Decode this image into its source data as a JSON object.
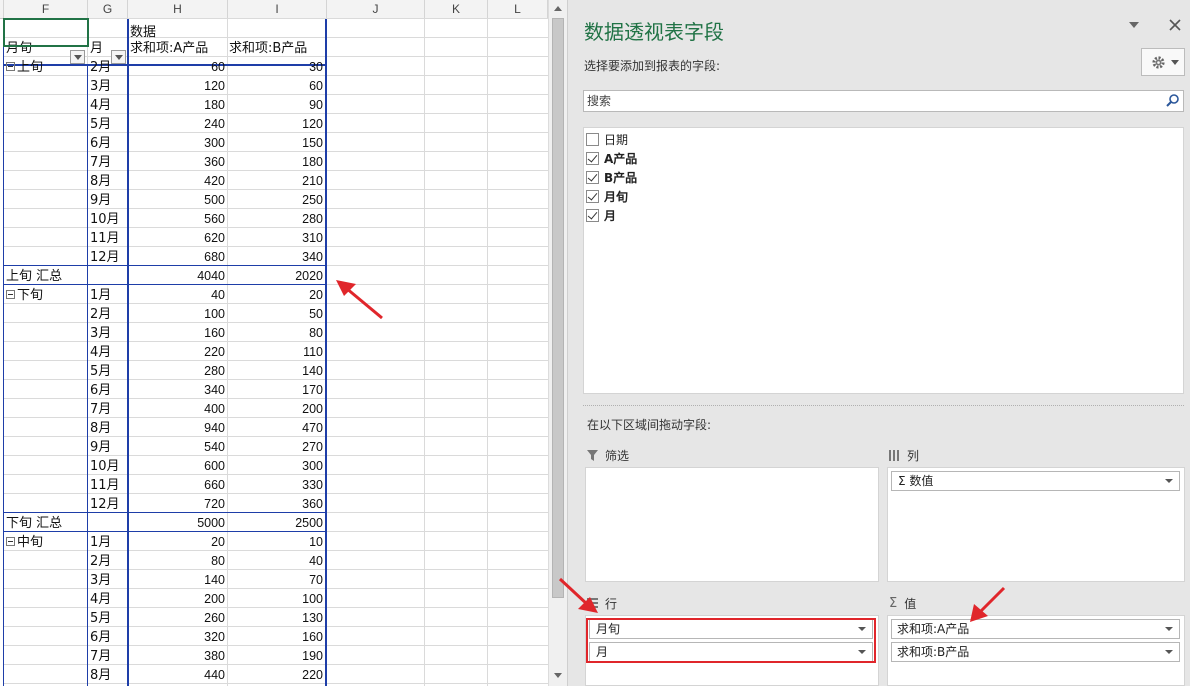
{
  "sheet": {
    "columns": [
      "F",
      "G",
      "H",
      "I",
      "J",
      "K",
      "L"
    ],
    "pivot": {
      "header_data": "数据",
      "hdr_row": "月旬",
      "hdr_month": "月",
      "hdr_a": "求和项:A产品",
      "hdr_b": "求和项:B产品",
      "groups": [
        {
          "name": "上旬",
          "rows": [
            [
              "2月",
              "60",
              "30"
            ],
            [
              "3月",
              "120",
              "60"
            ],
            [
              "4月",
              "180",
              "90"
            ],
            [
              "5月",
              "240",
              "120"
            ],
            [
              "6月",
              "300",
              "150"
            ],
            [
              "7月",
              "360",
              "180"
            ],
            [
              "8月",
              "420",
              "210"
            ],
            [
              "9月",
              "500",
              "250"
            ],
            [
              "10月",
              "560",
              "280"
            ],
            [
              "11月",
              "620",
              "310"
            ],
            [
              "12月",
              "680",
              "340"
            ]
          ],
          "subtotal_label": "上旬 汇总",
          "subtotal_a": "4040",
          "subtotal_b": "2020"
        },
        {
          "name": "下旬",
          "rows": [
            [
              "1月",
              "40",
              "20"
            ],
            [
              "2月",
              "100",
              "50"
            ],
            [
              "3月",
              "160",
              "80"
            ],
            [
              "4月",
              "220",
              "110"
            ],
            [
              "5月",
              "280",
              "140"
            ],
            [
              "6月",
              "340",
              "170"
            ],
            [
              "7月",
              "400",
              "200"
            ],
            [
              "8月",
              "940",
              "470"
            ],
            [
              "9月",
              "540",
              "270"
            ],
            [
              "10月",
              "600",
              "300"
            ],
            [
              "11月",
              "660",
              "330"
            ],
            [
              "12月",
              "720",
              "360"
            ]
          ],
          "subtotal_label": "下旬 汇总",
          "subtotal_a": "5000",
          "subtotal_b": "2500"
        },
        {
          "name": "中旬",
          "rows": [
            [
              "1月",
              "20",
              "10"
            ],
            [
              "2月",
              "80",
              "40"
            ],
            [
              "3月",
              "140",
              "70"
            ],
            [
              "4月",
              "200",
              "100"
            ],
            [
              "5月",
              "260",
              "130"
            ],
            [
              "6月",
              "320",
              "160"
            ],
            [
              "7月",
              "380",
              "190"
            ],
            [
              "8月",
              "440",
              "220"
            ]
          ]
        }
      ]
    }
  },
  "pane": {
    "title": "数据透视表字段",
    "choose_label": "选择要添加到报表的字段:",
    "search_placeholder": "搜索",
    "fields": [
      {
        "label": "日期",
        "checked": false
      },
      {
        "label": "A产品",
        "checked": true
      },
      {
        "label": "B产品",
        "checked": true
      },
      {
        "label": "月旬",
        "checked": true
      },
      {
        "label": "月",
        "checked": true
      }
    ],
    "drag_label": "在以下区域间拖动字段:",
    "areas": {
      "filter_title": "筛选",
      "columns_title": "列",
      "columns_items": [
        "Σ 数值"
      ],
      "rows_title": "行",
      "rows_items": [
        "月旬",
        "月"
      ],
      "values_title": "值",
      "values_items": [
        "求和项:A产品",
        "求和项:B产品"
      ]
    },
    "accent_color": "#217346",
    "highlight_color": "#e0262b"
  }
}
